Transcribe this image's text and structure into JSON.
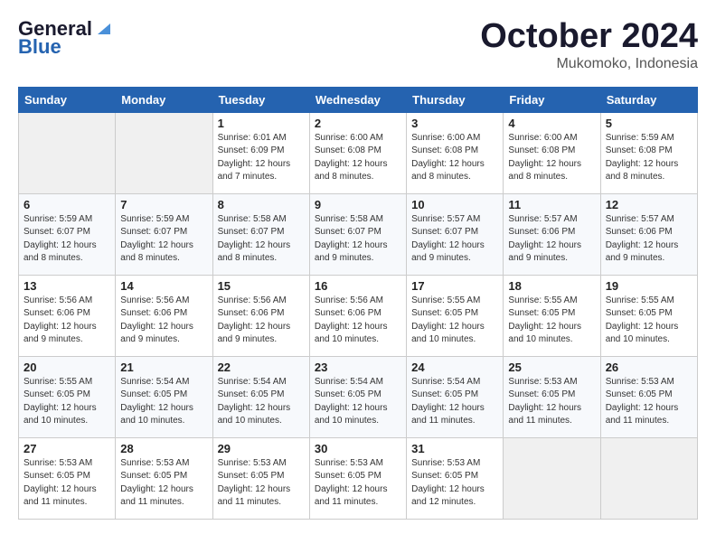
{
  "header": {
    "logo_line1": "General",
    "logo_line2": "Blue",
    "month": "October 2024",
    "location": "Mukomoko, Indonesia"
  },
  "weekdays": [
    "Sunday",
    "Monday",
    "Tuesday",
    "Wednesday",
    "Thursday",
    "Friday",
    "Saturday"
  ],
  "weeks": [
    [
      {
        "day": "",
        "empty": true
      },
      {
        "day": "",
        "empty": true
      },
      {
        "day": "1",
        "sunrise": "Sunrise: 6:01 AM",
        "sunset": "Sunset: 6:09 PM",
        "daylight": "Daylight: 12 hours and 7 minutes."
      },
      {
        "day": "2",
        "sunrise": "Sunrise: 6:00 AM",
        "sunset": "Sunset: 6:08 PM",
        "daylight": "Daylight: 12 hours and 8 minutes."
      },
      {
        "day": "3",
        "sunrise": "Sunrise: 6:00 AM",
        "sunset": "Sunset: 6:08 PM",
        "daylight": "Daylight: 12 hours and 8 minutes."
      },
      {
        "day": "4",
        "sunrise": "Sunrise: 6:00 AM",
        "sunset": "Sunset: 6:08 PM",
        "daylight": "Daylight: 12 hours and 8 minutes."
      },
      {
        "day": "5",
        "sunrise": "Sunrise: 5:59 AM",
        "sunset": "Sunset: 6:08 PM",
        "daylight": "Daylight: 12 hours and 8 minutes."
      }
    ],
    [
      {
        "day": "6",
        "sunrise": "Sunrise: 5:59 AM",
        "sunset": "Sunset: 6:07 PM",
        "daylight": "Daylight: 12 hours and 8 minutes."
      },
      {
        "day": "7",
        "sunrise": "Sunrise: 5:59 AM",
        "sunset": "Sunset: 6:07 PM",
        "daylight": "Daylight: 12 hours and 8 minutes."
      },
      {
        "day": "8",
        "sunrise": "Sunrise: 5:58 AM",
        "sunset": "Sunset: 6:07 PM",
        "daylight": "Daylight: 12 hours and 8 minutes."
      },
      {
        "day": "9",
        "sunrise": "Sunrise: 5:58 AM",
        "sunset": "Sunset: 6:07 PM",
        "daylight": "Daylight: 12 hours and 9 minutes."
      },
      {
        "day": "10",
        "sunrise": "Sunrise: 5:57 AM",
        "sunset": "Sunset: 6:07 PM",
        "daylight": "Daylight: 12 hours and 9 minutes."
      },
      {
        "day": "11",
        "sunrise": "Sunrise: 5:57 AM",
        "sunset": "Sunset: 6:06 PM",
        "daylight": "Daylight: 12 hours and 9 minutes."
      },
      {
        "day": "12",
        "sunrise": "Sunrise: 5:57 AM",
        "sunset": "Sunset: 6:06 PM",
        "daylight": "Daylight: 12 hours and 9 minutes."
      }
    ],
    [
      {
        "day": "13",
        "sunrise": "Sunrise: 5:56 AM",
        "sunset": "Sunset: 6:06 PM",
        "daylight": "Daylight: 12 hours and 9 minutes."
      },
      {
        "day": "14",
        "sunrise": "Sunrise: 5:56 AM",
        "sunset": "Sunset: 6:06 PM",
        "daylight": "Daylight: 12 hours and 9 minutes."
      },
      {
        "day": "15",
        "sunrise": "Sunrise: 5:56 AM",
        "sunset": "Sunset: 6:06 PM",
        "daylight": "Daylight: 12 hours and 9 minutes."
      },
      {
        "day": "16",
        "sunrise": "Sunrise: 5:56 AM",
        "sunset": "Sunset: 6:06 PM",
        "daylight": "Daylight: 12 hours and 10 minutes."
      },
      {
        "day": "17",
        "sunrise": "Sunrise: 5:55 AM",
        "sunset": "Sunset: 6:05 PM",
        "daylight": "Daylight: 12 hours and 10 minutes."
      },
      {
        "day": "18",
        "sunrise": "Sunrise: 5:55 AM",
        "sunset": "Sunset: 6:05 PM",
        "daylight": "Daylight: 12 hours and 10 minutes."
      },
      {
        "day": "19",
        "sunrise": "Sunrise: 5:55 AM",
        "sunset": "Sunset: 6:05 PM",
        "daylight": "Daylight: 12 hours and 10 minutes."
      }
    ],
    [
      {
        "day": "20",
        "sunrise": "Sunrise: 5:55 AM",
        "sunset": "Sunset: 6:05 PM",
        "daylight": "Daylight: 12 hours and 10 minutes."
      },
      {
        "day": "21",
        "sunrise": "Sunrise: 5:54 AM",
        "sunset": "Sunset: 6:05 PM",
        "daylight": "Daylight: 12 hours and 10 minutes."
      },
      {
        "day": "22",
        "sunrise": "Sunrise: 5:54 AM",
        "sunset": "Sunset: 6:05 PM",
        "daylight": "Daylight: 12 hours and 10 minutes."
      },
      {
        "day": "23",
        "sunrise": "Sunrise: 5:54 AM",
        "sunset": "Sunset: 6:05 PM",
        "daylight": "Daylight: 12 hours and 10 minutes."
      },
      {
        "day": "24",
        "sunrise": "Sunrise: 5:54 AM",
        "sunset": "Sunset: 6:05 PM",
        "daylight": "Daylight: 12 hours and 11 minutes."
      },
      {
        "day": "25",
        "sunrise": "Sunrise: 5:53 AM",
        "sunset": "Sunset: 6:05 PM",
        "daylight": "Daylight: 12 hours and 11 minutes."
      },
      {
        "day": "26",
        "sunrise": "Sunrise: 5:53 AM",
        "sunset": "Sunset: 6:05 PM",
        "daylight": "Daylight: 12 hours and 11 minutes."
      }
    ],
    [
      {
        "day": "27",
        "sunrise": "Sunrise: 5:53 AM",
        "sunset": "Sunset: 6:05 PM",
        "daylight": "Daylight: 12 hours and 11 minutes."
      },
      {
        "day": "28",
        "sunrise": "Sunrise: 5:53 AM",
        "sunset": "Sunset: 6:05 PM",
        "daylight": "Daylight: 12 hours and 11 minutes."
      },
      {
        "day": "29",
        "sunrise": "Sunrise: 5:53 AM",
        "sunset": "Sunset: 6:05 PM",
        "daylight": "Daylight: 12 hours and 11 minutes."
      },
      {
        "day": "30",
        "sunrise": "Sunrise: 5:53 AM",
        "sunset": "Sunset: 6:05 PM",
        "daylight": "Daylight: 12 hours and 11 minutes."
      },
      {
        "day": "31",
        "sunrise": "Sunrise: 5:53 AM",
        "sunset": "Sunset: 6:05 PM",
        "daylight": "Daylight: 12 hours and 12 minutes."
      },
      {
        "day": "",
        "empty": true
      },
      {
        "day": "",
        "empty": true
      }
    ]
  ]
}
